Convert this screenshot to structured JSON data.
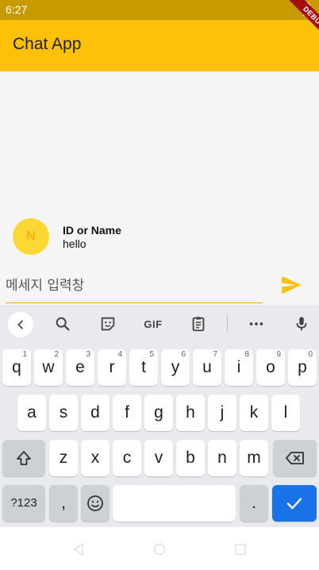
{
  "status_bar": {
    "time": "6:27"
  },
  "debug_banner": {
    "label": "DEBUG"
  },
  "app_bar": {
    "title": "Chat App"
  },
  "messages": [
    {
      "avatar_initial": "N",
      "sender": "ID or Name",
      "text": "hello"
    }
  ],
  "composer": {
    "placeholder": "메세지 입력창",
    "send_icon": "send-icon"
  },
  "colors": {
    "primary": "#ffc107",
    "status_bar": "#c79a00",
    "avatar": "#fdd835",
    "accent": "#ffa000",
    "keyboard_bg": "#e8eaed",
    "enter_key": "#1a73e8"
  },
  "keyboard": {
    "toolbar_icons": [
      "back-icon",
      "search-icon",
      "sticker-icon",
      "gif-icon",
      "clipboard-icon",
      "more-icon",
      "mic-icon"
    ],
    "gif_label": "GIF",
    "row1": [
      {
        "key": "q",
        "hint": "1"
      },
      {
        "key": "w",
        "hint": "2"
      },
      {
        "key": "e",
        "hint": "3"
      },
      {
        "key": "r",
        "hint": "4"
      },
      {
        "key": "t",
        "hint": "5"
      },
      {
        "key": "y",
        "hint": "6"
      },
      {
        "key": "u",
        "hint": "7"
      },
      {
        "key": "i",
        "hint": "8"
      },
      {
        "key": "o",
        "hint": "9"
      },
      {
        "key": "p",
        "hint": "0"
      }
    ],
    "row2": [
      "a",
      "s",
      "d",
      "f",
      "g",
      "h",
      "j",
      "k",
      "l"
    ],
    "row3": [
      "z",
      "x",
      "c",
      "v",
      "b",
      "n",
      "m"
    ],
    "symbols_label": "?123",
    "comma": ",",
    "period": "."
  }
}
